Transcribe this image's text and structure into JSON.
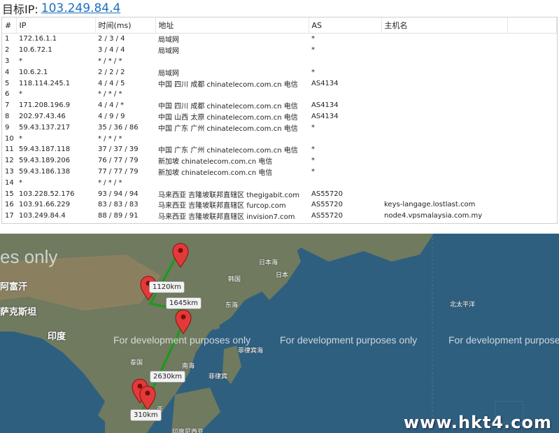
{
  "header": {
    "label": "目标IP:",
    "target_ip": "103.249.84.4"
  },
  "table": {
    "columns": [
      "#",
      "IP",
      "时间(ms)",
      "地址",
      "AS",
      "主机名"
    ],
    "rows": [
      {
        "n": "1",
        "ip": "172.16.1.1",
        "time": "2 / 3 / 4",
        "addr": "局域网",
        "as": "*",
        "host": ""
      },
      {
        "n": "2",
        "ip": "10.6.72.1",
        "time": "3 / 4 / 4",
        "addr": "局域网",
        "as": "*",
        "host": ""
      },
      {
        "n": "3",
        "ip": "*",
        "time": "* / * / *",
        "addr": "",
        "as": "",
        "host": ""
      },
      {
        "n": "4",
        "ip": "10.6.2.1",
        "time": "2 / 2 / 2",
        "addr": "局域网",
        "as": "*",
        "host": ""
      },
      {
        "n": "5",
        "ip": "118.114.245.1",
        "time": "4 / 4 / 5",
        "addr": "中国 四川 成都 chinatelecom.com.cn 电信",
        "as": "AS4134",
        "host": ""
      },
      {
        "n": "6",
        "ip": "*",
        "time": "* / * / *",
        "addr": "",
        "as": "",
        "host": ""
      },
      {
        "n": "7",
        "ip": "171.208.196.9",
        "time": "4 / 4 / *",
        "addr": "中国 四川 成都 chinatelecom.com.cn 电信",
        "as": "AS4134",
        "host": ""
      },
      {
        "n": "8",
        "ip": "202.97.43.46",
        "time": "4 / 9 / 9",
        "addr": "中国 山西 太原 chinatelecom.com.cn 电信",
        "as": "AS4134",
        "host": ""
      },
      {
        "n": "9",
        "ip": "59.43.137.217",
        "time": "35 / 36 / 86",
        "addr": "中国 广东 广州 chinatelecom.com.cn 电信",
        "as": "*",
        "host": ""
      },
      {
        "n": "10",
        "ip": "*",
        "time": "* / * / *",
        "addr": "",
        "as": "",
        "host": ""
      },
      {
        "n": "11",
        "ip": "59.43.187.118",
        "time": "37 / 37 / 39",
        "addr": "中国 广东 广州 chinatelecom.com.cn 电信",
        "as": "*",
        "host": ""
      },
      {
        "n": "12",
        "ip": "59.43.189.206",
        "time": "76 / 77 / 79",
        "addr": "新加坡 chinatelecom.com.cn 电信",
        "as": "*",
        "host": ""
      },
      {
        "n": "13",
        "ip": "59.43.186.138",
        "time": "77 / 77 / 79",
        "addr": "新加坡 chinatelecom.com.cn 电信",
        "as": "*",
        "host": ""
      },
      {
        "n": "14",
        "ip": "*",
        "time": "* / * / *",
        "addr": "",
        "as": "",
        "host": ""
      },
      {
        "n": "15",
        "ip": "103.228.52.176",
        "time": "93 / 94 / 94",
        "addr": "马来西亚 吉隆坡联邦直辖区 thegigabit.com",
        "as": "AS55720",
        "host": ""
      },
      {
        "n": "16",
        "ip": "103.91.66.229",
        "time": "83 / 83 / 83",
        "addr": "马来西亚 吉隆坡联邦直辖区 furcop.com",
        "as": "AS55720",
        "host": "keys-langage.lostlast.com"
      },
      {
        "n": "17",
        "ip": "103.249.84.4",
        "time": "88 / 89 / 91",
        "addr": "马来西亚 吉隆坡联邦直辖区 invision7.com",
        "as": "AS55720",
        "host": "node4.vpsmalaysia.com.my"
      }
    ]
  },
  "map": {
    "watermark_big": "es only",
    "watermark": "For development purposes only",
    "watermark_cut": "For development purpose",
    "labels": {
      "kazakh": "萨克斯坦",
      "hetian": "阿富汗",
      "india": "印度",
      "thailand": "泰国",
      "korea": "韩国",
      "japan": "日本",
      "japan_sea": "日本海",
      "east_sea": "东海",
      "south_sea": "南海",
      "philippines": "菲律宾",
      "philippine_sea": "菲律宾海",
      "north_pacific": "北太平洋",
      "malaysia": "亚",
      "indonesia": "印度尼西亚"
    },
    "distances": [
      "1120km",
      "1645km",
      "2630km",
      "310km"
    ],
    "route_color": "#1a9a1a",
    "marker_color": "#e23a3a",
    "brand": "www.hkt4.com"
  }
}
